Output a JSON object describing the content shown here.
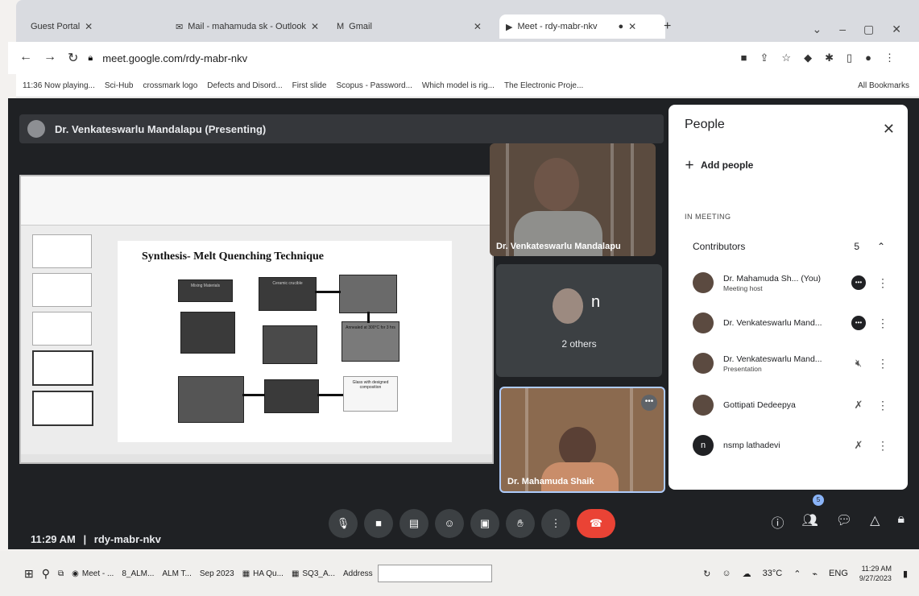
{
  "browser": {
    "tabs": [
      {
        "label": "Guest Portal"
      },
      {
        "label": "Mail - mahamuda sk - Outlook"
      },
      {
        "label": "Gmail"
      },
      {
        "label": "Meet - rdy-mabr-nkv"
      }
    ],
    "url": "meet.google.com/rdy-mabr-nkv",
    "bookmarks": [
      "11:36 Now playing...",
      "Sci-Hub",
      "crossmark logo",
      "Defects and Disord...",
      "First slide",
      "Scopus - Password...",
      "Which model is rig...",
      "The Electronic Proje..."
    ],
    "all_bookmarks": "All Bookmarks"
  },
  "meet": {
    "presenting_label": "Dr. Venkateswarlu Mandalapu (Presenting)",
    "slide_title": "Synthesis- Melt Quenching Technique",
    "slide_boxes": [
      "Mixing Materials",
      "Ceramic crucible",
      "",
      "",
      "",
      "Annealed at 300°C for 3 hrs",
      "Glass with designed composition",
      "",
      ""
    ],
    "tiles": {
      "presenter_name": "Dr. Venkateswarlu Mandalapu",
      "others_initial": "n",
      "others_label": "2 others",
      "self_name": "Dr. Mahamuda Shaik"
    },
    "time": "11:29 AM",
    "separator": "|",
    "code": "rdy-mabr-nkv",
    "people_badge": "5"
  },
  "people": {
    "title": "People",
    "add_people": "Add people",
    "in_meeting": "IN MEETING",
    "contributors": "Contributors",
    "contributors_count": "5",
    "list": [
      {
        "name": "Dr. Mahamuda Sh...",
        "you": "(You)",
        "sub": "Meeting host",
        "initial": ""
      },
      {
        "name": "Dr. Venkateswarlu Mand...",
        "you": "",
        "sub": "",
        "initial": ""
      },
      {
        "name": "Dr. Venkateswarlu Mand...",
        "you": "",
        "sub": "Presentation",
        "initial": ""
      },
      {
        "name": "Gottipati Dedeepya",
        "you": "",
        "sub": "",
        "initial": ""
      },
      {
        "name": "nsmp lathadevi",
        "you": "",
        "sub": "",
        "initial": "n"
      }
    ]
  },
  "taskbar": {
    "items": [
      "Meet - ...",
      "8_ALM...",
      "ALM T...",
      "Sep 2023",
      "HA Qu...",
      "SQ3_A..."
    ],
    "address_label": "Address",
    "temp": "33°C",
    "lang": "ENG",
    "time": "11:29 AM",
    "date": "9/27/2023"
  }
}
